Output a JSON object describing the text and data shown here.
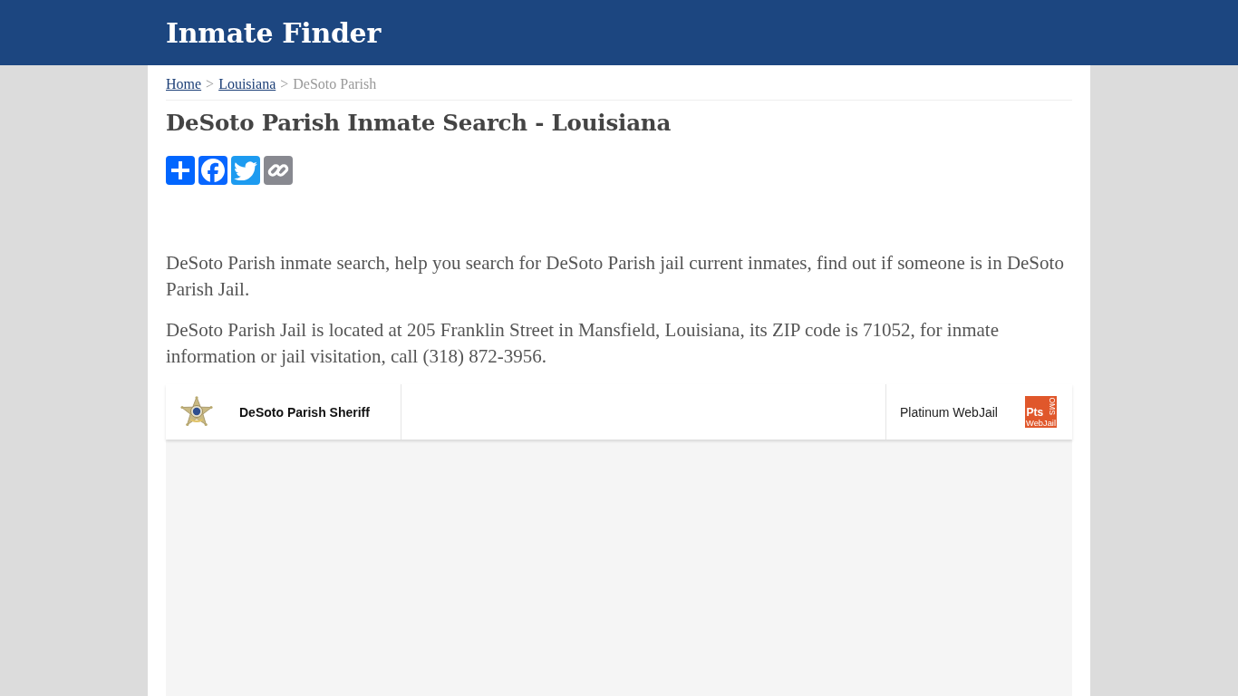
{
  "header": {
    "site_title": "Inmate Finder"
  },
  "breadcrumb": [
    {
      "kind": "link",
      "text": "Home"
    },
    {
      "kind": "separator",
      "text": ">"
    },
    {
      "kind": "link",
      "text": "Louisiana"
    },
    {
      "kind": "separator",
      "text": ">"
    },
    {
      "kind": "current",
      "text": "DeSoto Parish"
    }
  ],
  "page_title": "DeSoto Parish Inmate Search - Louisiana",
  "share_buttons": [
    {
      "kind": "add"
    },
    {
      "kind": "facebook"
    },
    {
      "kind": "twitter"
    },
    {
      "kind": "copy_link"
    }
  ],
  "paragraphs": [
    "DeSoto Parish inmate search, help you search for DeSoto Parish jail current inmates, find out if someone is in DeSoto Parish Jail.",
    "DeSoto Parish Jail is located at 205 Franklin Street in Mansfield, Louisiana, its ZIP code is 71052, for inmate information or jail visitation, call (318) 872-3956."
  ],
  "embed": {
    "agency_name": "DeSoto Parish Sheriff",
    "product_name": "Platinum WebJail",
    "logo": {
      "main": "Pts",
      "sub": "WebJail",
      "side": "OMS"
    }
  }
}
